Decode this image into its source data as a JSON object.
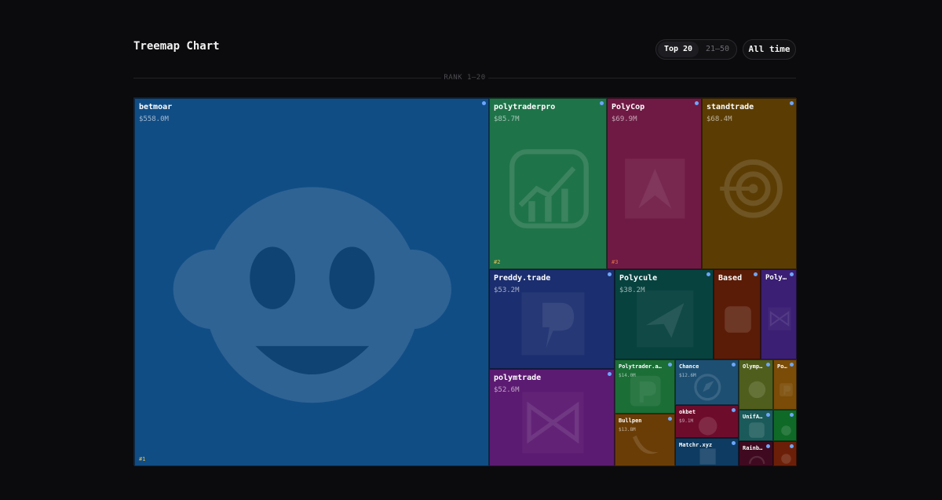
{
  "header": {
    "title": "Treemap Chart"
  },
  "controls": {
    "rank_tabs": [
      {
        "label": "Top 20",
        "active": true
      },
      {
        "label": "21–50",
        "active": false
      }
    ],
    "time_range": "All time"
  },
  "divider_label": "RANK 1–20",
  "chart_data": {
    "type": "treemap",
    "unit": "$M",
    "items": [
      {
        "rank": 1,
        "name": "betmoar",
        "value": 558.0,
        "label": "$558.0M",
        "color": "#114d85",
        "logo": "monkey-icon"
      },
      {
        "rank": 2,
        "name": "polytraderpro",
        "value": 85.7,
        "label": "$85.7M",
        "color": "#1f7349",
        "logo": "chart-app-icon"
      },
      {
        "rank": 3,
        "name": "PolyCop",
        "value": 69.9,
        "label": "$69.9M",
        "color": "#6f1a44",
        "logo": "a-logo-icon"
      },
      {
        "rank": 4,
        "name": "standtrade",
        "value": 68.4,
        "label": "$68.4M",
        "color": "#5b3d04",
        "logo": "target-icon"
      },
      {
        "rank": 5,
        "name": "Preddy.trade",
        "value": 53.2,
        "label": "$53.2M",
        "color": "#1b2e6f",
        "logo": "p-bolt-icon"
      },
      {
        "rank": 6,
        "name": "polymtrade",
        "value": 52.6,
        "label": "$52.6M",
        "color": "#5c1b72",
        "logo": "bowtie-icon"
      },
      {
        "rank": 7,
        "name": "Polycule",
        "value": 38.2,
        "label": "$38.2M",
        "color": "#07423f",
        "logo": "paper-plane-icon"
      },
      {
        "rank": 8,
        "name": "Based",
        "value": 20.0,
        "label": "",
        "color": "#5a1c07",
        "logo": "b-logo-icon"
      },
      {
        "rank": 9,
        "name": "PolyBot",
        "value": 15.0,
        "label": "",
        "color": "#3b1f74",
        "logo": "bowtie-icon"
      },
      {
        "rank": 10,
        "name": "Polytrader.a…",
        "value": 14.0,
        "label": "$14.0M",
        "color": "#1a6e36",
        "logo": "p-logo-icon"
      },
      {
        "rank": 11,
        "name": "Bullpen",
        "value": 13.8,
        "label": "$13.8M",
        "color": "#6b3d06",
        "logo": "banana-icon"
      },
      {
        "rank": 12,
        "name": "Chance",
        "value": 12.6,
        "label": "$12.6M",
        "color": "#1d4f73",
        "logo": "compass-icon"
      },
      {
        "rank": 13,
        "name": "okbet",
        "value": 9.1,
        "label": "$9.1M",
        "color": "#6e0c2c",
        "logo": "ball-icon"
      },
      {
        "rank": 14,
        "name": "Matchr.xyz",
        "value": 7.0,
        "label": "",
        "color": "#0d3b62",
        "logo": "m-logo-icon"
      },
      {
        "rank": 15,
        "name": "Olympusx…",
        "value": 6.0,
        "label": "",
        "color": "#4f5e1c",
        "logo": "o-logo-icon"
      },
      {
        "rank": 16,
        "name": "Polydu…",
        "value": 5.5,
        "label": "",
        "color": "#7a4c07",
        "logo": "p-logo-icon"
      },
      {
        "rank": 17,
        "name": "UnifAI Ne…",
        "value": 4.5,
        "label": "",
        "color": "#1a5a5a",
        "logo": "u-logo-icon"
      },
      {
        "rank": 18,
        "name": "",
        "value": 3.8,
        "label": "",
        "color": "#0f6a27",
        "logo": "dot-icon"
      },
      {
        "rank": 19,
        "name": "Rainbow",
        "value": 3.0,
        "label": "",
        "color": "#3f0a1f",
        "logo": "rainbow-icon"
      },
      {
        "rank": 20,
        "name": "",
        "value": 2.8,
        "label": "",
        "color": "#6c1f08",
        "logo": "dot-icon"
      }
    ]
  }
}
